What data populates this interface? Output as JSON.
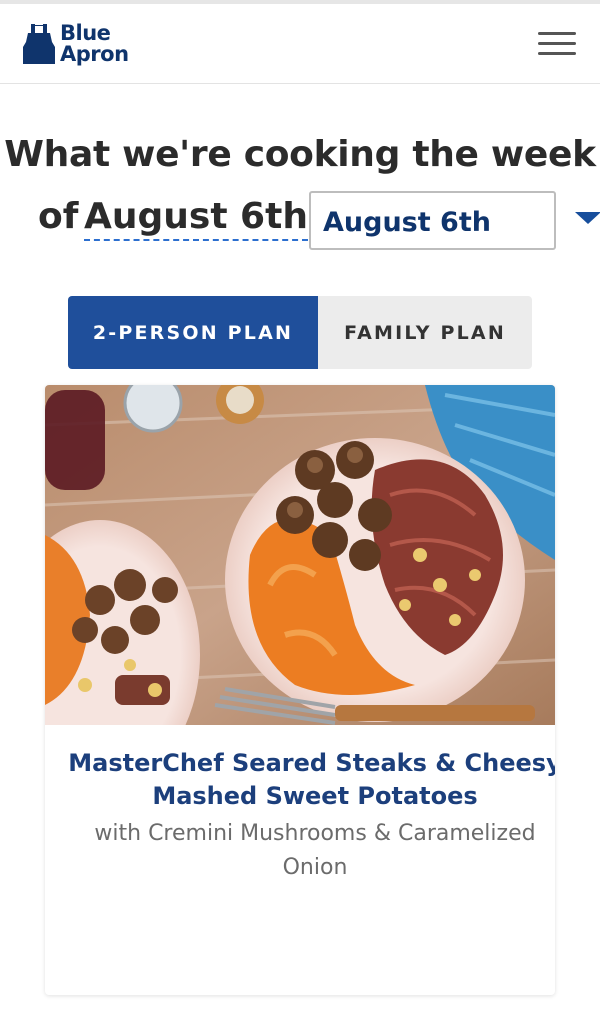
{
  "brand": {
    "name_line1": "Blue",
    "name_line2": "Apron",
    "color": "#0f346c"
  },
  "header": {
    "menu_icon": "hamburger-menu-icon"
  },
  "heading": {
    "line1": "What we're cooking the week",
    "line2_prefix": "of",
    "week": "August 6th"
  },
  "week_selector": {
    "value": "August 6th",
    "icon": "caret-down-icon"
  },
  "plans": {
    "active": "2-PERSON PLAN",
    "inactive": "FAMILY PLAN",
    "active_color": "#1f4f9b"
  },
  "recipe": {
    "title": "MasterChef Seared Steaks & Cheesy Mashed Sweet Potatoes",
    "subtitle": "with Cremini Mushrooms & Caramelized Onion",
    "image_alt": "steak-plate-photo"
  }
}
